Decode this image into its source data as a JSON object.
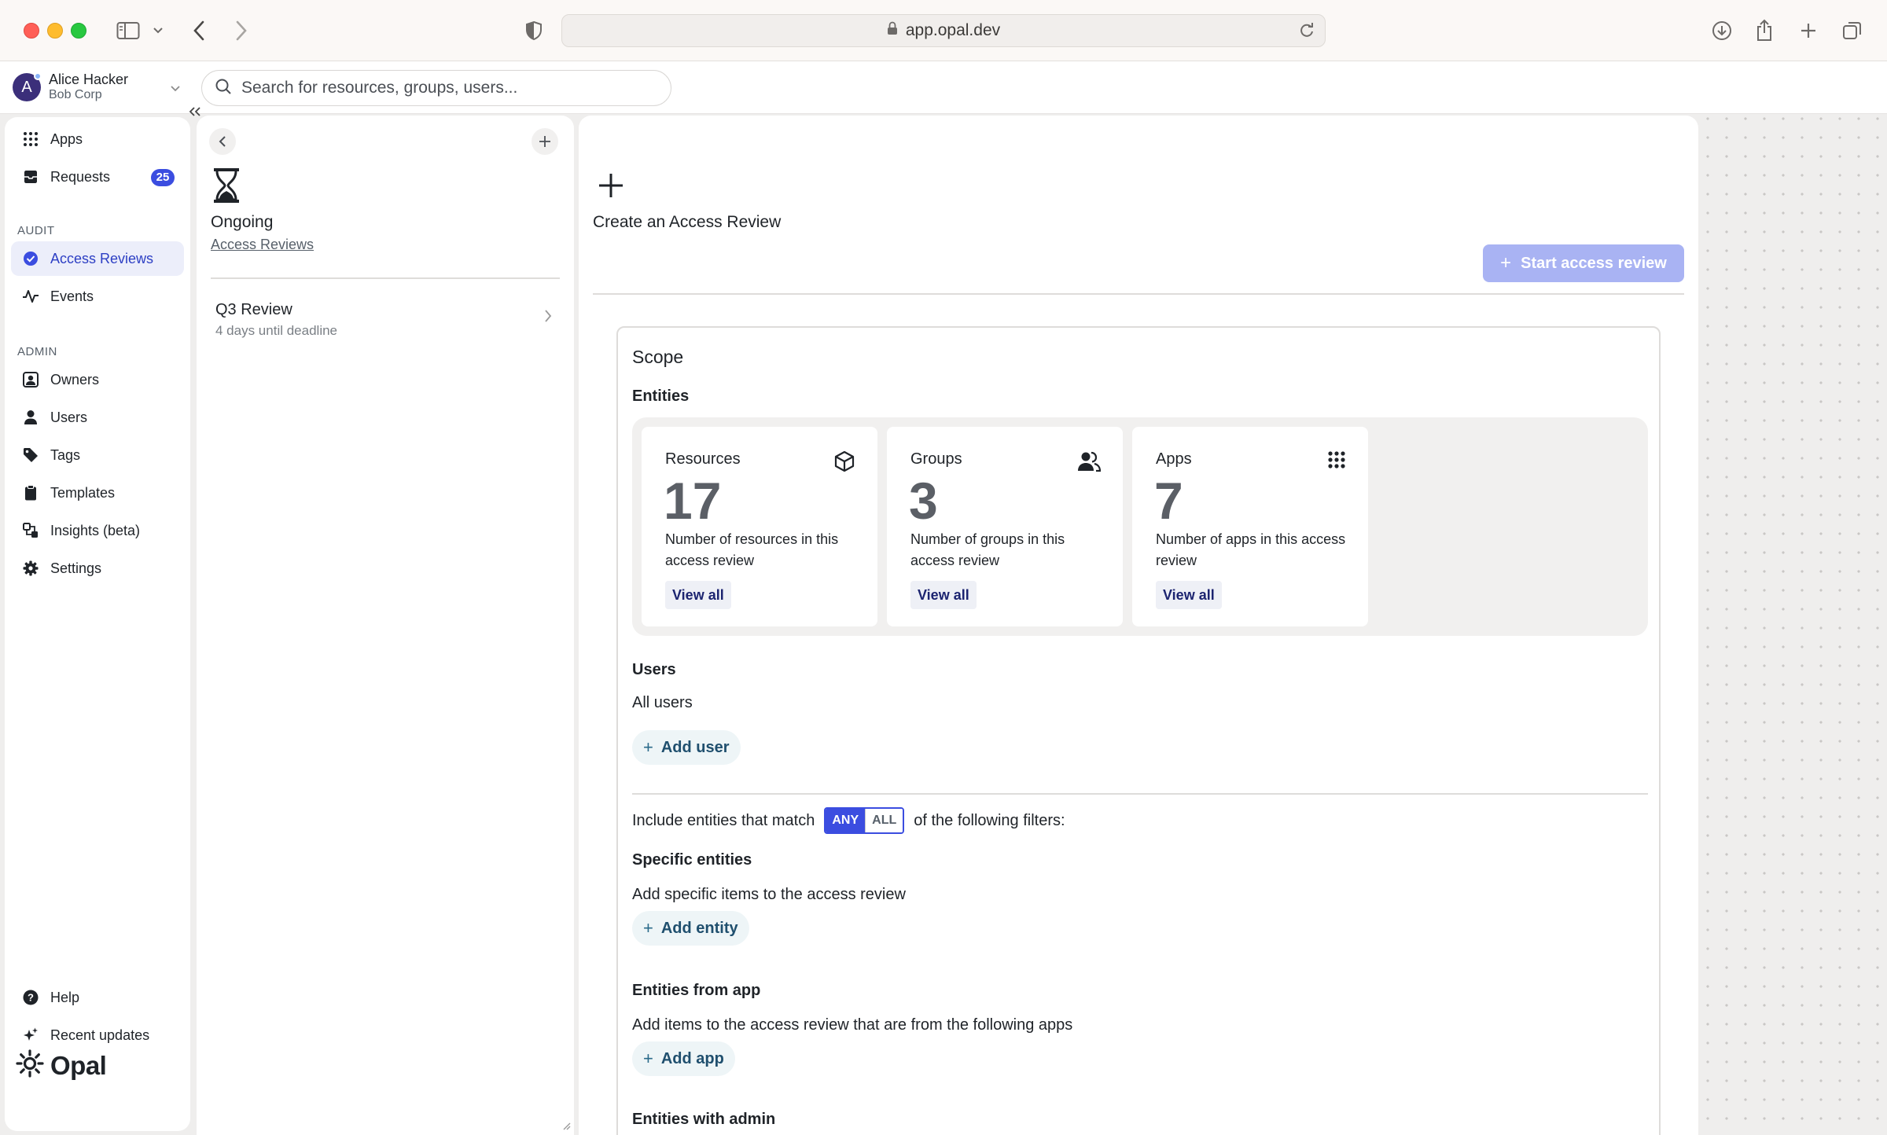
{
  "browser": {
    "url": "app.opal.dev"
  },
  "account": {
    "initial": "A",
    "name": "Alice Hacker",
    "org": "Bob Corp"
  },
  "search": {
    "placeholder": "Search for resources, groups, users..."
  },
  "nav": {
    "apps": "Apps",
    "requests": "Requests",
    "requests_badge": "25",
    "audit_section": "AUDIT",
    "access_reviews": "Access Reviews",
    "events": "Events",
    "admin_section": "ADMIN",
    "owners": "Owners",
    "users": "Users",
    "tags": "Tags",
    "templates": "Templates",
    "insights": "Insights (beta)",
    "settings": "Settings",
    "help": "Help",
    "recent_updates": "Recent updates",
    "logo_text": "Opal"
  },
  "middle": {
    "title": "Ongoing",
    "link": "Access Reviews",
    "reviews": [
      {
        "title": "Q3 Review",
        "subtitle": "4 days until deadline"
      }
    ]
  },
  "main": {
    "title": "Create an Access Review",
    "start_button": "Start access review",
    "scope": {
      "title": "Scope",
      "entities_label": "Entities",
      "cards": [
        {
          "title": "Resources",
          "count": "17",
          "desc": "Number of resources in this access review",
          "button": "View all",
          "icon": "cube-icon"
        },
        {
          "title": "Groups",
          "count": "3",
          "desc": "Number of groups in this access review",
          "button": "View all",
          "icon": "users-icon"
        },
        {
          "title": "Apps",
          "count": "7",
          "desc": "Number of apps in this access review",
          "button": "View all",
          "icon": "grid-icon"
        }
      ],
      "users_label": "Users",
      "users_value": "All users",
      "add_user": "Add user",
      "match_prefix": "Include entities that match",
      "match_any": "ANY",
      "match_all": "ALL",
      "match_suffix": "of the following filters:",
      "specific_label": "Specific entities",
      "specific_desc": "Add specific items to the access review",
      "add_entity": "Add entity",
      "from_app_label": "Entities from app",
      "from_app_desc": "Add items to the access review that are from the following apps",
      "add_app": "Add app",
      "admin_label": "Entities with admin"
    }
  },
  "colors": {
    "accent": "#3b4de0",
    "accent_disabled": "#a9b3f3",
    "active_nav_bg": "#eceefa"
  }
}
